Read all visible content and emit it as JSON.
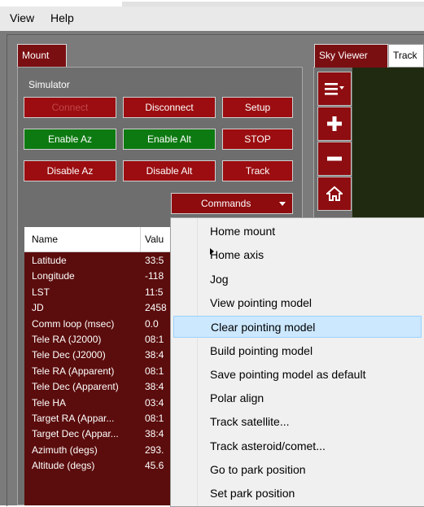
{
  "menubar": {
    "items": [
      "View",
      "Help"
    ]
  },
  "tabs": {
    "mount": "Mount",
    "sky_viewer": "Sky Viewer",
    "track": "Track"
  },
  "mount": {
    "group_label": "Simulator",
    "buttons": {
      "connect": "Connect",
      "disconnect": "Disconnect",
      "setup": "Setup",
      "enable_az": "Enable Az",
      "enable_alt": "Enable Alt",
      "stop": "STOP",
      "disable_az": "Disable Az",
      "disable_alt": "Disable Alt",
      "track": "Track",
      "commands": "Commands"
    }
  },
  "table": {
    "headers": [
      "Name",
      "Valu"
    ],
    "rows": [
      [
        "Latitude",
        "33:5"
      ],
      [
        "Longitude",
        "-118"
      ],
      [
        "LST",
        "11:5"
      ],
      [
        "JD",
        "2458"
      ],
      [
        "Comm loop (msec)",
        "0.0"
      ],
      [
        "Tele RA (J2000)",
        "08:1"
      ],
      [
        "Tele Dec (J2000)",
        "38:4"
      ],
      [
        "Tele RA (Apparent)",
        "08:1"
      ],
      [
        "Tele Dec (Apparent)",
        "38:4"
      ],
      [
        "Tele HA",
        "03:4"
      ],
      [
        "Target RA (Appar...",
        "08:1"
      ],
      [
        "Target Dec (Appar...",
        "38:4"
      ],
      [
        "Azimuth (degs)",
        "293."
      ],
      [
        "Altitude (degs)",
        "45.6"
      ]
    ]
  },
  "context_menu": {
    "items": [
      "Home mount",
      "Home axis",
      "Jog",
      "View pointing model",
      "Clear pointing model",
      "Build pointing model",
      "Save pointing model as default",
      "Polar align",
      "Track satellite...",
      "Track asteroid/comet...",
      "Go to park position",
      "Set park position"
    ],
    "selected_index": 4,
    "submenu_index": 1
  },
  "icons": {
    "sky_tools": [
      "menu-icon",
      "zoom-in-icon",
      "zoom-out-icon",
      "home-icon"
    ],
    "submenu": "chevron-right-icon",
    "dropdown": "chevron-down-icon"
  },
  "colors": {
    "button_red": "#9b0d10",
    "button_green": "#0d7a11",
    "panel_gray": "#6e6e6e",
    "table_bg": "#5b0c0c",
    "menu_highlight": "#cce8ff"
  }
}
